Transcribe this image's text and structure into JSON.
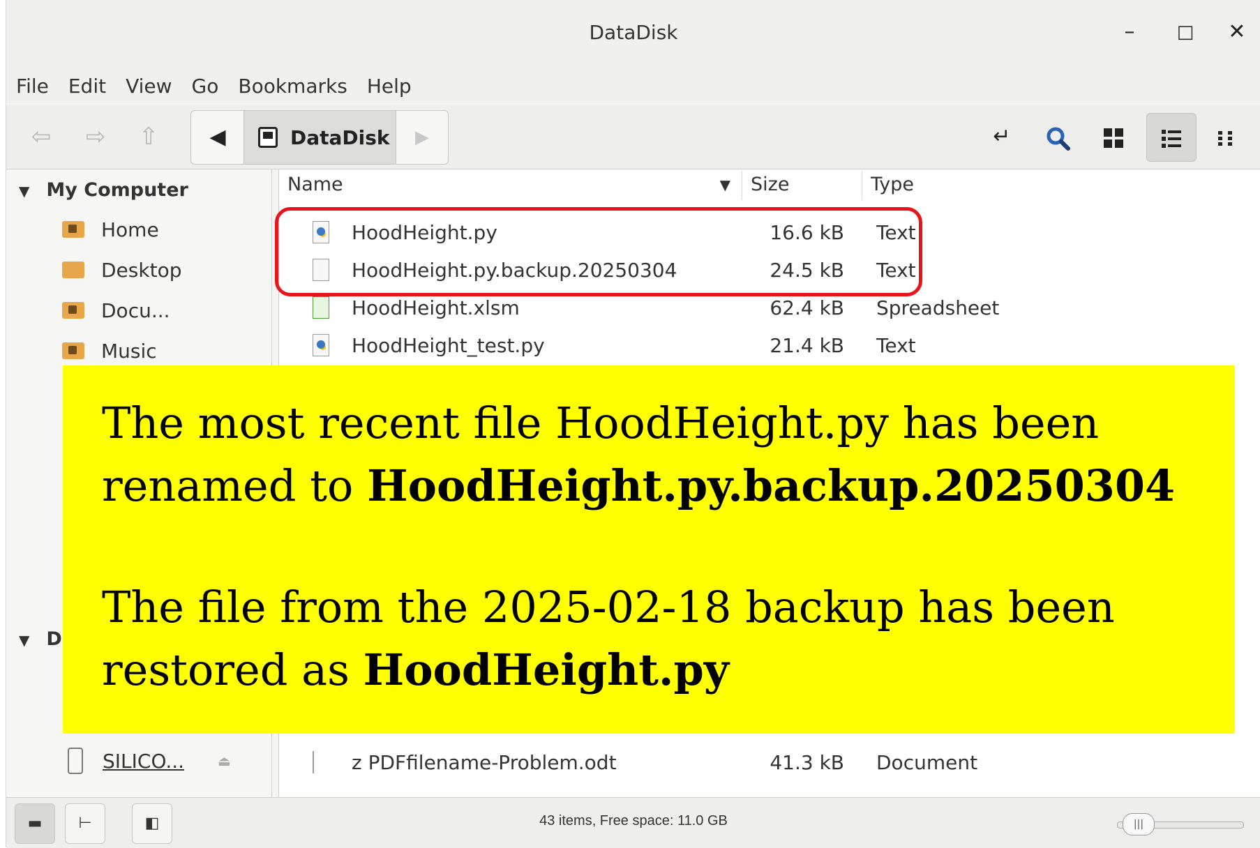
{
  "window": {
    "title": "DataDisk",
    "minimize_glyph": "–",
    "maximize_glyph": "□",
    "close_glyph": "✕"
  },
  "menu": [
    "File",
    "Edit",
    "View",
    "Go",
    "Bookmarks",
    "Help"
  ],
  "toolbar": {
    "breadcrumb": "DataDisk",
    "icons": [
      "back-icon",
      "forward-icon",
      "up-icon",
      "toggle-location-icon",
      "search-icon",
      "icon-view-icon",
      "list-view-icon",
      "compact-view-icon"
    ]
  },
  "sidebar": {
    "section_my_computer": "My Computer",
    "items": [
      "Home",
      "Desktop",
      "Docu...",
      "Music"
    ],
    "section_devices_initial": "D",
    "device": "SILICO..."
  },
  "columns": {
    "name": "Name",
    "size": "Size",
    "type": "Type"
  },
  "files": [
    {
      "name": "HoodHeight.py",
      "size": "16.6 kB",
      "type": "Text",
      "icon": "python"
    },
    {
      "name": "HoodHeight.py.backup.20250304",
      "size": "24.5 kB",
      "type": "Text",
      "icon": "text"
    },
    {
      "name": "HoodHeight.xlsm",
      "size": "62.4 kB",
      "type": "Spreadsheet",
      "icon": "spreadsheet"
    },
    {
      "name": "HoodHeight_test.py",
      "size": "21.4 kB",
      "type": "Text",
      "icon": "python"
    },
    {
      "name": "z PDFfilename-Problem.odt",
      "size": "41.3 kB",
      "type": "Document",
      "icon": "document"
    }
  ],
  "note": {
    "line1_plain": "The most recent file HoodHeight.py has been renamed to ",
    "line1_bold": "HoodHeight.py.backup.20250304",
    "line2_plain": "The file from the 2025-02-18 backup has been restored as ",
    "line2_bold": "HoodHeight.py",
    "background": "#ffff00"
  },
  "status": {
    "text": "43 items, Free space: 11.0 GB"
  },
  "colors": {
    "highlight_border": "#e8141c"
  }
}
